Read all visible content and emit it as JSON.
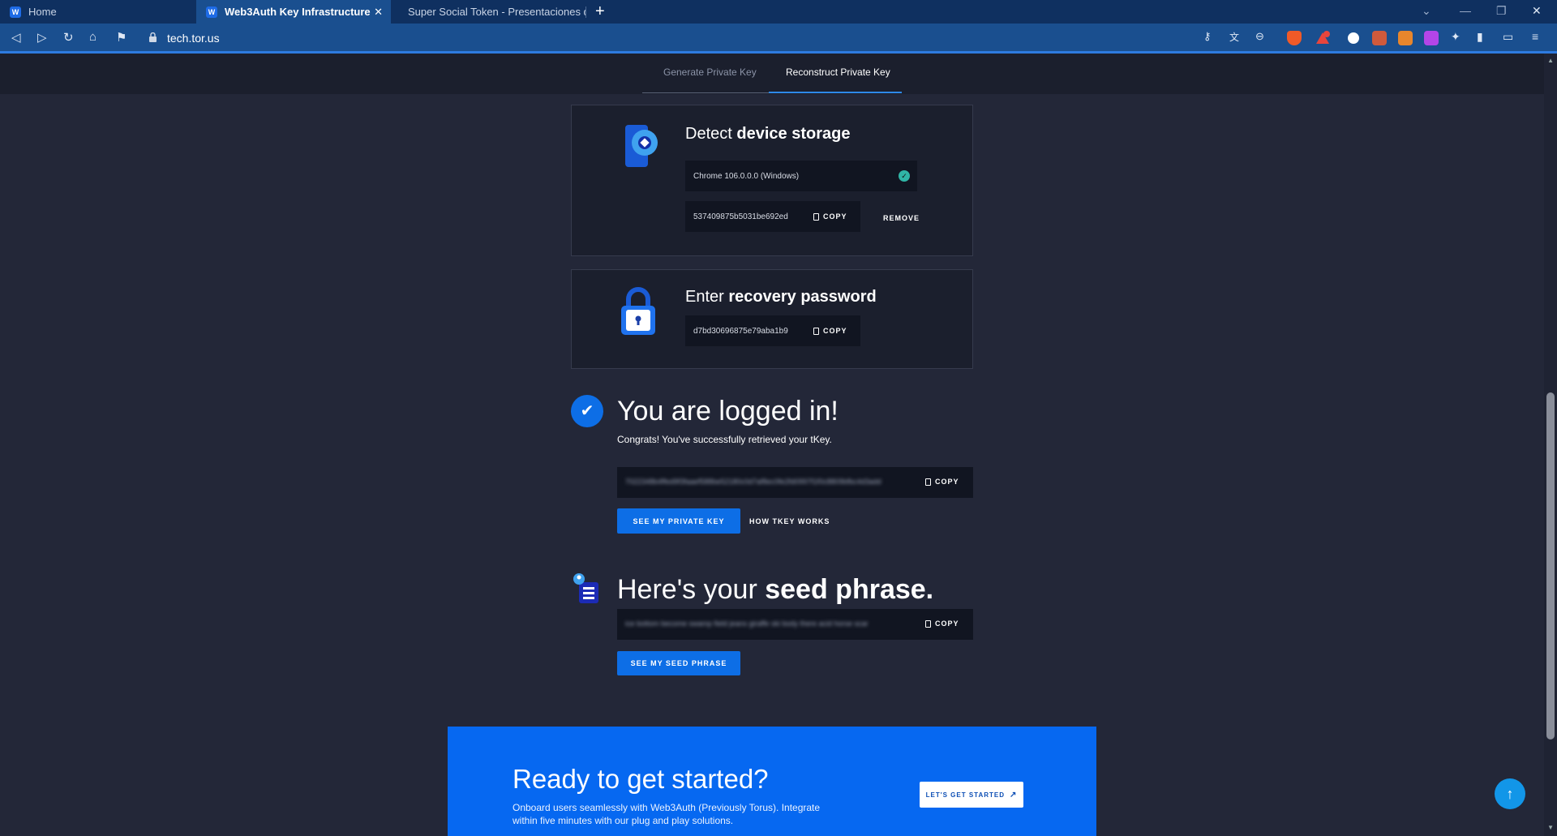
{
  "browser": {
    "tabs": [
      {
        "label": "Home",
        "favicon": "W"
      },
      {
        "label": "Web3Auth Key Infrastructure",
        "favicon": "W"
      },
      {
        "label": "Super Social Token - Presentaciones d",
        "favicon": "slides"
      }
    ],
    "url": "tech.tor.us",
    "new_tab_label": "+",
    "close_tab_label": "✕"
  },
  "subnav": {
    "generate": "Generate Private Key",
    "reconstruct": "Reconstruct Private Key"
  },
  "device_card": {
    "title_prefix": "Detect",
    "title_bold": "device storage",
    "device_name": "Chrome 106.0.0.0 (Windows)",
    "share_value": "537409875b5031be692ed",
    "copy_label": "COPY",
    "remove_label": "REMOVE"
  },
  "password_card": {
    "title_prefix": "Enter",
    "title_bold": "recovery password",
    "share_value": "d7bd30696875e79aba1b9",
    "copy_label": "COPY"
  },
  "logged_in": {
    "title": "You are logged in!",
    "subtitle": "Congrats! You've successfully retrieved your tKey.",
    "key_value": "7022348b4ffed9f3faaef588be52180c0d7af8ec0fe2fd0997f1f0c8809bfbc4d3add",
    "copy_label": "COPY",
    "see_key_button": "SEE MY PRIVATE KEY",
    "how_works": "HOW TKEY WORKS"
  },
  "seed": {
    "title_prefix": "Here's your",
    "title_bold": "seed phrase.",
    "phrase": "ice bottom become swamp field jeans giraffe ski body there acid horse scar",
    "copy_label": "COPY",
    "see_seed_button": "SEE MY SEED PHRASE"
  },
  "cta": {
    "title": "Ready to get started?",
    "text": "Onboard users seamlessly with Web3Auth (Previously Torus). Integrate within five minutes with our plug and play solutions.",
    "button": "LET'S GET STARTED"
  },
  "colors": {
    "accent": "#0668f1",
    "page_bg": "#232738",
    "card_bg": "#1b1f2d"
  }
}
